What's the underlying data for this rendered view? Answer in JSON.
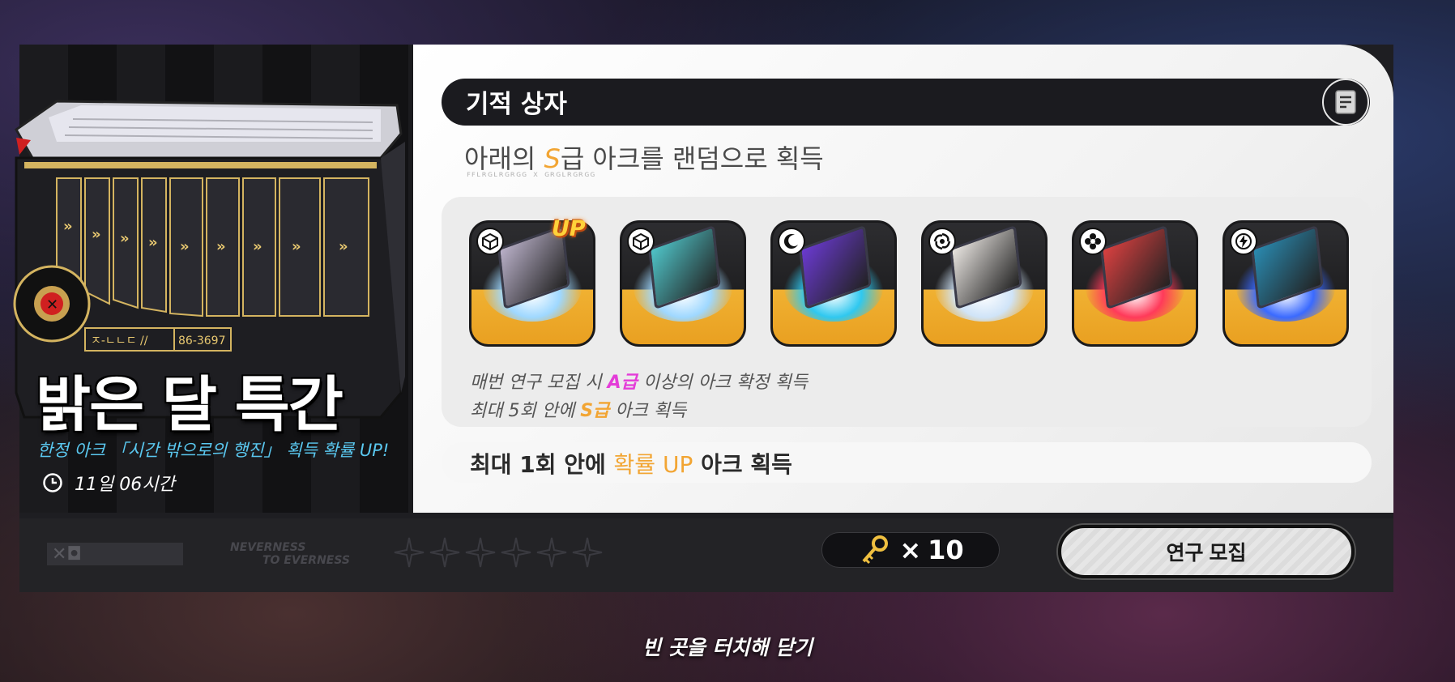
{
  "promo": {
    "title": "밝은 달 특간",
    "subtitle": "한정 아크 「시간 밖으로의 행진」 획득 확률 UP!",
    "timer": "11일 06시간",
    "crate_labels": [
      "ㅈ-ㄴㄴㄷ //",
      "86-3697"
    ]
  },
  "box": {
    "title": "기적 상자",
    "subtitle_prefix": "아래의 ",
    "subtitle_grade": "S",
    "subtitle_suffix": "급 아크를 랜덤으로 획득",
    "code_text": "ꜰꜰʟʀɢʟʀɢʀɢɢ x ɢʀɢʟʀɢʀɢɢ"
  },
  "items": [
    {
      "type_icon": "cube-icon",
      "up": true,
      "ring": "#9fd8ff",
      "art": "#b9b0c8"
    },
    {
      "type_icon": "cube-icon",
      "up": false,
      "ring": "#9fd8ff",
      "art": "#4fc4c8"
    },
    {
      "type_icon": "moon-icon",
      "up": false,
      "ring": "#2fc8f0",
      "art": "#6a3ad0"
    },
    {
      "type_icon": "vortex-icon",
      "up": false,
      "ring": "#d0e4f8",
      "art": "#e8e4e0"
    },
    {
      "type_icon": "flower-icon",
      "up": false,
      "ring": "#ff3a5a",
      "art": "#d84040"
    },
    {
      "type_icon": "lightning-icon",
      "up": false,
      "ring": "#3a6aff",
      "art": "#2a8ab0"
    }
  ],
  "up_label": "UP",
  "rules": {
    "line1_pre": "매번 연구 모집 시 ",
    "line1_grade": "A급",
    "line1_post": " 이상의 아크 확정 획득",
    "line2_pre": "최대 5회 안에 ",
    "line2_grade": "S급",
    "line2_post": " 아크 획득"
  },
  "pity": {
    "pre": "최대 1회 안에 ",
    "highlight": "확률 UP",
    "post": " 아크 획득"
  },
  "bottom": {
    "tag": "✕◘",
    "brand_line1": "NEVERNESS",
    "brand_line2": "TO EVERNESS",
    "star_count": 6,
    "cost_prefix": "× ",
    "cost_value": "10",
    "recruit_label": "연구 모집"
  },
  "close_hint": "빈 곳을 터치해 닫기",
  "colors": {
    "accent": "#f2a533",
    "a_grade": "#e43cd8",
    "sub_blue": "#5ac8f0"
  }
}
